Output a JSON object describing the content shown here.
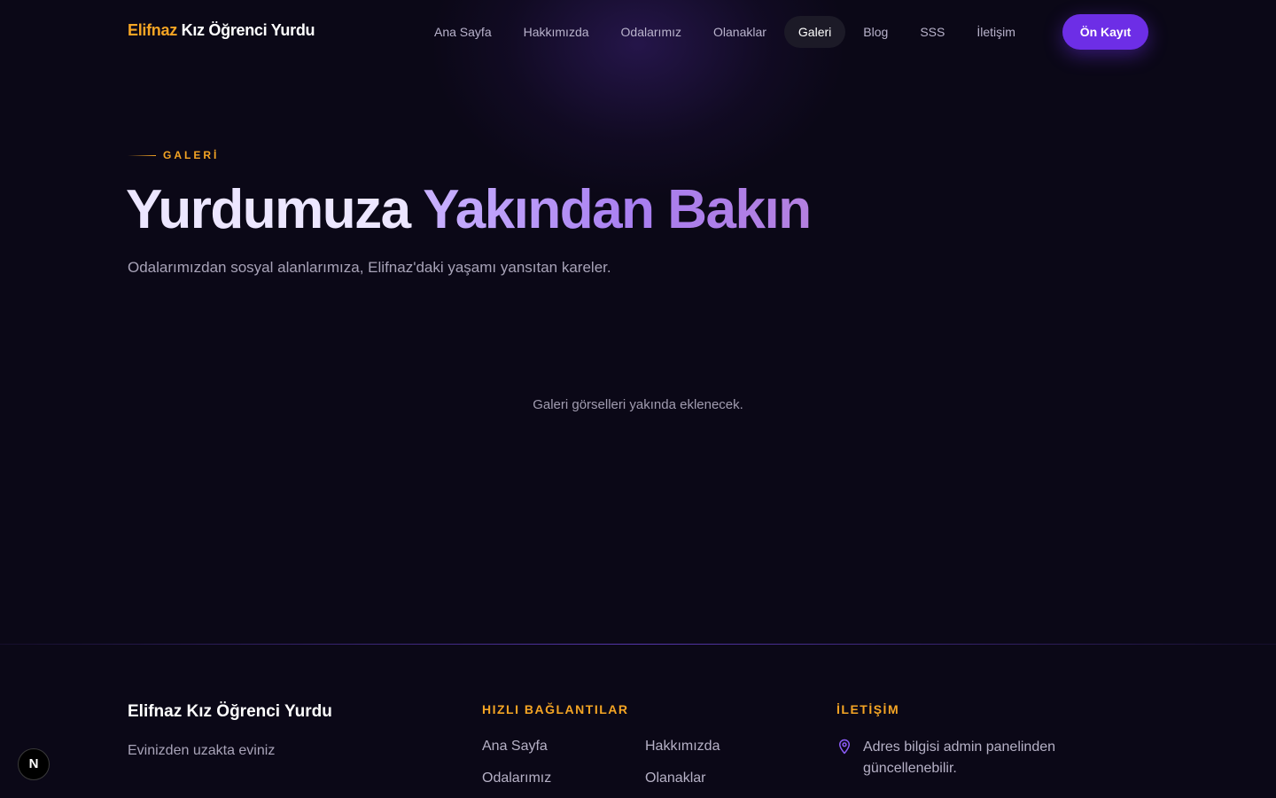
{
  "header": {
    "brand_accent": "Elifnaz",
    "brand_rest": "Kız Öğrenci Yurdu",
    "nav": [
      {
        "label": "Ana Sayfa"
      },
      {
        "label": "Hakkımızda"
      },
      {
        "label": "Odalarımız"
      },
      {
        "label": "Olanaklar"
      },
      {
        "label": "Galeri",
        "active": true
      },
      {
        "label": "Blog"
      },
      {
        "label": "SSS"
      },
      {
        "label": "İletişim"
      }
    ],
    "cta_label": "Ön Kayıt"
  },
  "hero": {
    "eyebrow": "GALERİ",
    "title_part1": "Yurdumuza",
    "title_part2": "Yakından Bakın",
    "subtitle": "Odalarımızdan sosyal alanlarımıza, Elifnaz'daki yaşamı yansıtan kareler."
  },
  "gallery": {
    "empty_message": "Galeri görselleri yakında eklenecek."
  },
  "footer": {
    "brand": "Elifnaz Kız Öğrenci Yurdu",
    "tagline": "Evinizden uzakta eviniz",
    "quick_links_title": "HIZLI BAĞLANTILAR",
    "quick_links": [
      {
        "label": "Ana Sayfa"
      },
      {
        "label": "Hakkımızda"
      },
      {
        "label": "Odalarımız"
      },
      {
        "label": "Olanaklar"
      }
    ],
    "contact_title": "İLETİŞİM",
    "address": "Adres bilgisi admin panelinden güncellenebilir.",
    "address_icon": "map-pin-icon"
  },
  "dev_badge": {
    "label": "N"
  },
  "colors": {
    "background": "#0b0817",
    "accent_orange": "#f5a524",
    "accent_purple": "#6d2ee6",
    "active_nav_bg": "#1c1a27"
  }
}
